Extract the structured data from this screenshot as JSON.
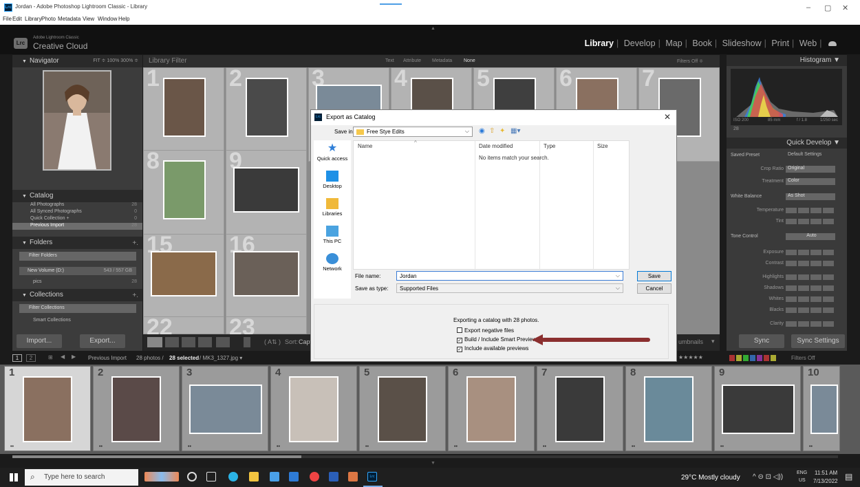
{
  "window": {
    "title": "Jordan - Adobe Photoshop Lightroom Classic - Library",
    "menu": [
      "File",
      "Edit",
      "Library",
      "Photo",
      "Metadata",
      "View",
      "Window",
      "Help"
    ]
  },
  "brand": {
    "small": "Adobe Lightroom Classic",
    "name": "Creative Cloud",
    "logo": "Lrc"
  },
  "modules": [
    "Library",
    "Develop",
    "Map",
    "Book",
    "Slideshow",
    "Print",
    "Web"
  ],
  "active_module": "Library",
  "left_panel": {
    "navigator": {
      "title": "Navigator",
      "zoom": "FIT ≑  100%  300% ≑"
    },
    "catalog": {
      "title": "Catalog",
      "rows": [
        {
          "label": "All Photographs",
          "count": "28"
        },
        {
          "label": "All Synced Photographs",
          "count": "0"
        },
        {
          "label": "Quick Collection +",
          "count": "0"
        },
        {
          "label": "Previous Import",
          "count": "28"
        }
      ]
    },
    "folders": {
      "title": "Folders",
      "filter": "Filter Folders",
      "volume": "New Volume (D:)",
      "volume_size": "543 / 557 GB",
      "pics": "pics",
      "pics_count": "28"
    },
    "collections": {
      "title": "Collections",
      "filter": "Filter Collections",
      "smart": "Smart Collections"
    },
    "buttons": {
      "import": "Import...",
      "export": "Export..."
    }
  },
  "filter_bar": {
    "title": "Library Filter",
    "options": [
      "Text",
      "Attribute",
      "Metadata",
      "None"
    ],
    "filters_off": "Filters Off ≑"
  },
  "grid": {
    "cells": [
      {
        "num": "1",
        "stars": "★★"
      },
      {
        "num": "2",
        "stars": "★★"
      },
      {
        "num": "3",
        "stars": ""
      },
      {
        "num": "4",
        "stars": ""
      },
      {
        "num": "5",
        "stars": ""
      },
      {
        "num": "6",
        "stars": ""
      },
      {
        "num": "7",
        "stars": ""
      },
      {
        "num": "8",
        "stars": "★★"
      },
      {
        "num": "9",
        "stars": "★★"
      },
      {
        "num": "15",
        "stars": ""
      },
      {
        "num": "16",
        "stars": "★"
      },
      {
        "num": "22",
        "stars": ""
      },
      {
        "num": "23",
        "stars": ""
      }
    ]
  },
  "toolbar": {
    "sort": "Sort:",
    "sort_value": "Capt",
    "thumbs": "umbnails"
  },
  "right_panel": {
    "histogram": {
      "title": "Histogram",
      "iso": "ISO 200",
      "focal": "85 mm",
      "aperture": "f / 1.8",
      "shutter": "1/250 sec",
      "count": "28"
    },
    "quick_develop": {
      "title": "Quick Develop",
      "saved_preset_label": "Saved Preset",
      "saved_preset": "Default Settings",
      "crop_label": "Crop Ratio",
      "crop": "Original",
      "treatment_label": "Treatment",
      "treatment": "Color",
      "wb_label": "White Balance",
      "wb": "As Shot",
      "temp_label": "Temperature",
      "tint_label": "Tint",
      "tone_label": "Tone Control",
      "auto": "Auto",
      "tone_rows": [
        "Exposure",
        "Contrast",
        "Highlights",
        "Shadows",
        "Whites",
        "Blacks",
        "Clarity"
      ]
    },
    "buttons": {
      "sync": "Sync",
      "sync_settings": "Sync Settings"
    }
  },
  "filmstrip_bar": {
    "source": "Previous Import",
    "info": "28 photos /",
    "selected": "28 selected",
    "file": "/ MK3_1327.jpg ▾",
    "filters_off": "Filters Off"
  },
  "filmstrip": {
    "cells": [
      {
        "num": "1",
        "stars": "••"
      },
      {
        "num": "2",
        "stars": "••"
      },
      {
        "num": "3",
        "stars": "••"
      },
      {
        "num": "4",
        "stars": "••"
      },
      {
        "num": "5",
        "stars": "••"
      },
      {
        "num": "6",
        "stars": "••"
      },
      {
        "num": "7",
        "stars": "••"
      },
      {
        "num": "8",
        "stars": "••"
      },
      {
        "num": "9",
        "stars": "••"
      },
      {
        "num": "10",
        "stars": "••"
      }
    ]
  },
  "dialog": {
    "title": "Export as Catalog",
    "save_in_label": "Save in:",
    "save_in": "Free Stye Edits",
    "places": [
      "Quick access",
      "Desktop",
      "Libraries",
      "This PC",
      "Network"
    ],
    "columns": [
      "Name",
      "Date modified",
      "Type",
      "Size"
    ],
    "empty_message": "No items match your search.",
    "file_name_label": "File name:",
    "file_name": "Jordan",
    "save_as_label": "Save as type:",
    "save_as": "Supported Files",
    "save_button": "Save",
    "cancel_button": "Cancel",
    "exporting_text": "Exporting a catalog with 28 photos.",
    "options": [
      {
        "label": "Export negative files",
        "checked": false
      },
      {
        "label": "Build / Include Smart Previews",
        "checked": true
      },
      {
        "label": "Include available previews",
        "checked": true
      }
    ]
  },
  "taskbar": {
    "search_placeholder": "Type here to search",
    "weather": "29°C  Mostly cloudy",
    "lang": "ENG",
    "region": "US",
    "time": "11:51 AM",
    "date": "7/13/2022"
  }
}
